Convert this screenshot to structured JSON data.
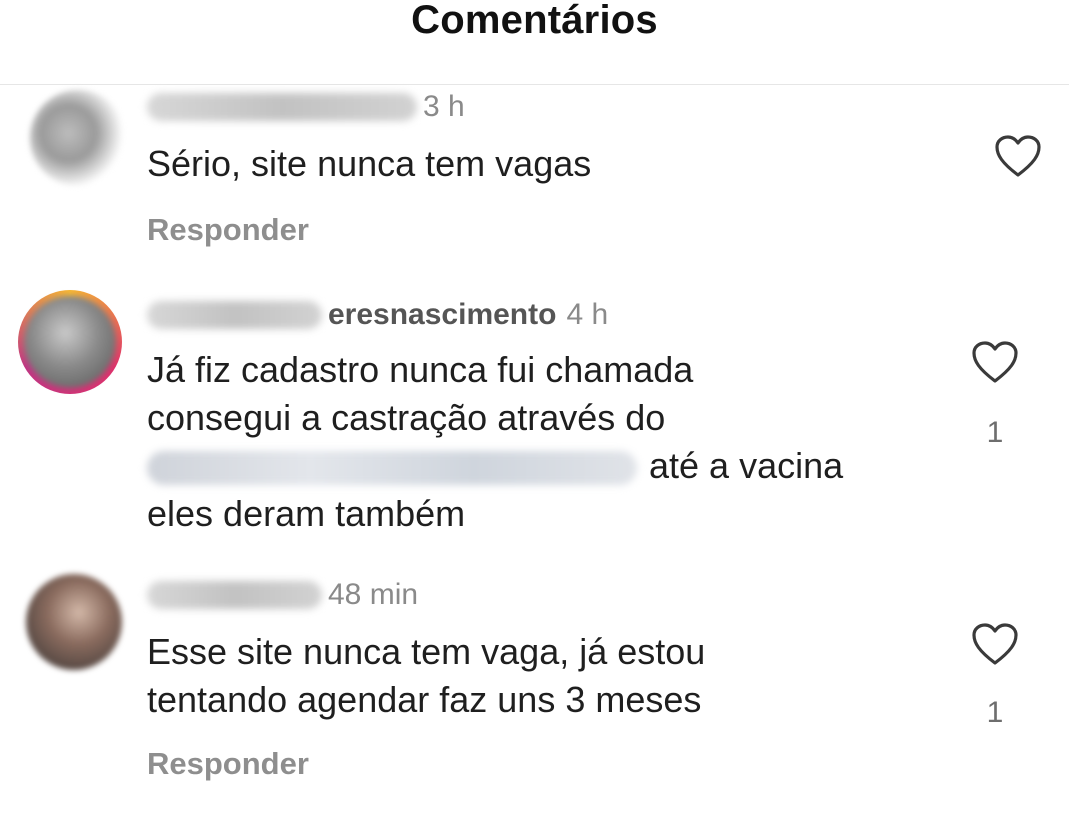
{
  "header": {
    "title": "Comentários"
  },
  "comments": [
    {
      "time": "3 h",
      "text": "Sério, site nunca tem vagas",
      "reply_label": "Responder"
    },
    {
      "username_visible": "eresnascimento",
      "time": "4 h",
      "text_line1": "Já fiz cadastro nunca fui chamada",
      "text_line2": "consegui a castração através do",
      "text_line3": "até a vacina",
      "text_line4": "eles deram também",
      "like_count": "1"
    },
    {
      "time": "48 min",
      "text_line1": "Esse site nunca tem vaga, já estou",
      "text_line2": "tentando agendar faz uns 3 meses",
      "like_count": "1",
      "reply_label": "Responder"
    }
  ],
  "icons": {
    "like": "heart-outline-icon"
  },
  "colors": {
    "text": "#1f1f1f",
    "muted": "#8e8e8e"
  }
}
